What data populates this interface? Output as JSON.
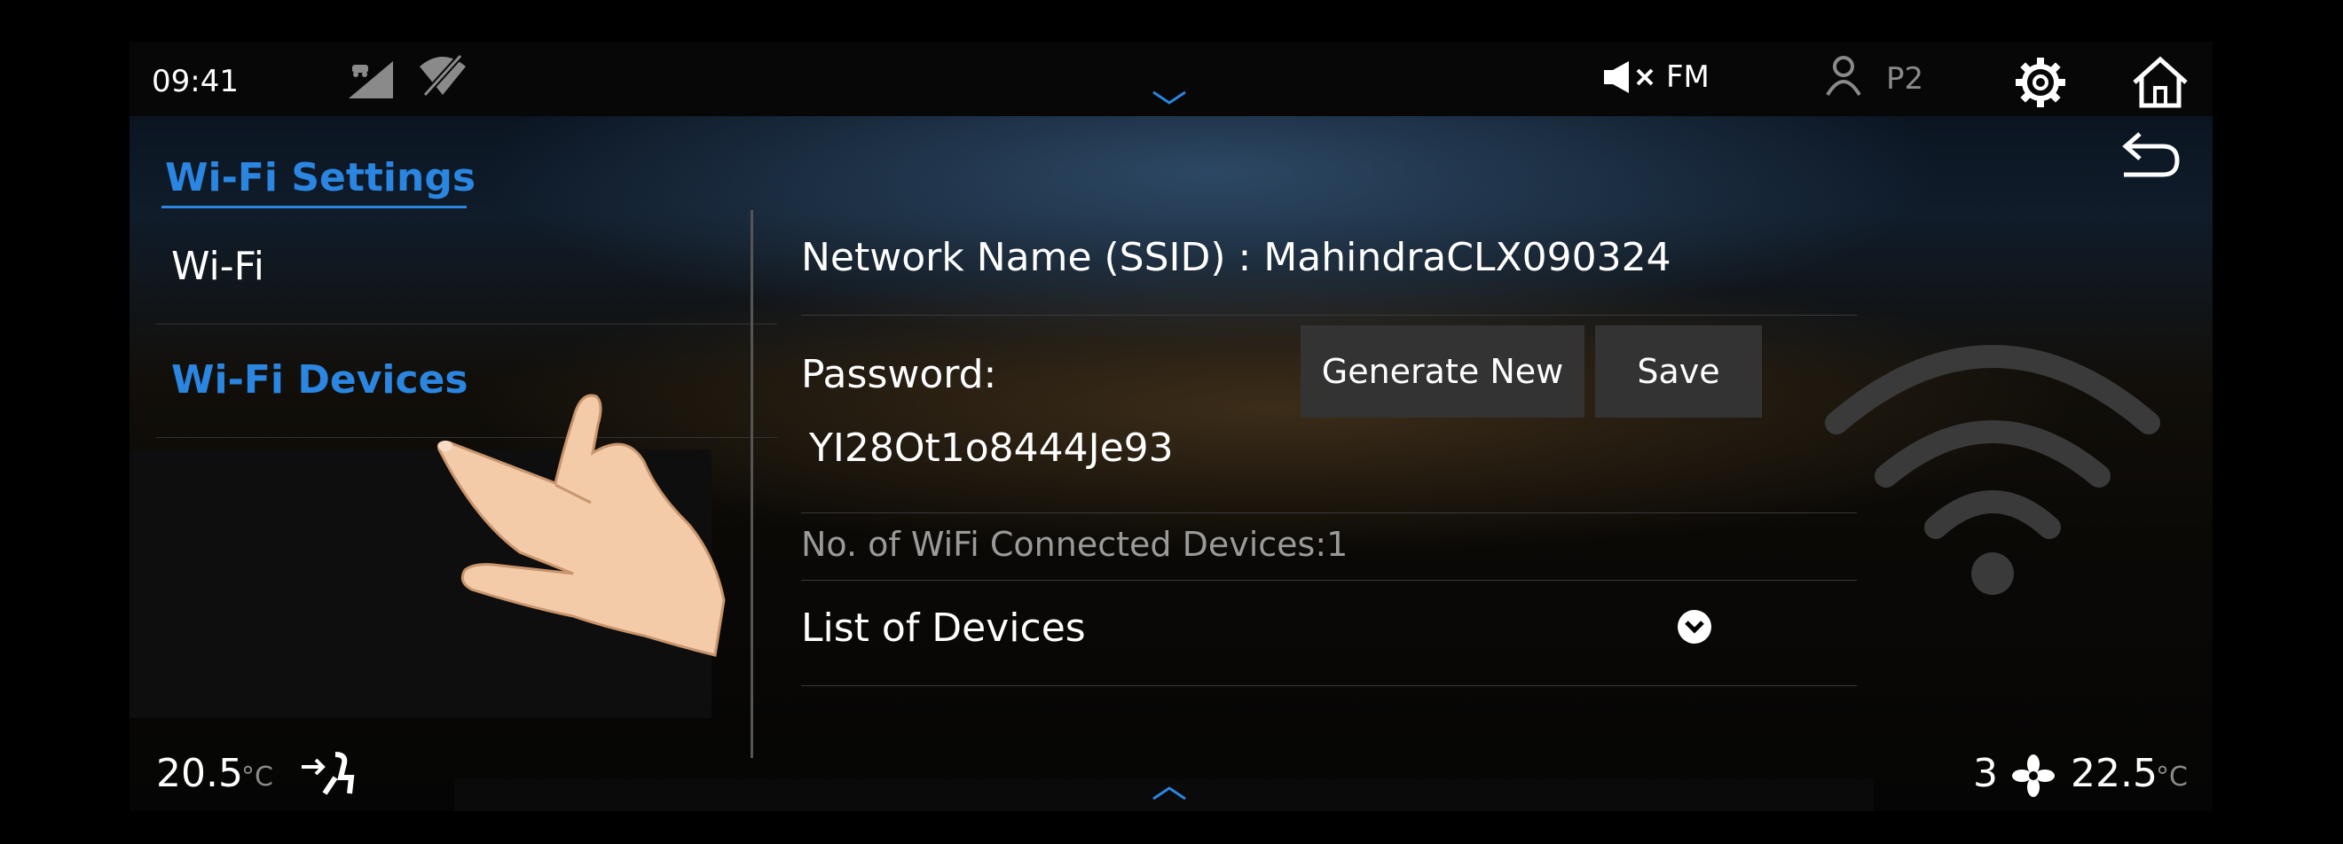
{
  "status_bar": {
    "time": "09:41",
    "audio_source": "FM",
    "profile": "P2"
  },
  "sidebar": {
    "title": "Wi-Fi Settings",
    "items": [
      {
        "label": "Wi-Fi",
        "active": false
      },
      {
        "label": "Wi-Fi Devices",
        "active": true
      }
    ]
  },
  "main": {
    "network_name": "Network Name (SSID) : MahindraCLX090324",
    "password_label": "Password:",
    "password_value": "YI28Ot1o8444Je93",
    "generate_new_label": "Generate New",
    "save_label": "Save",
    "connected_devices": "No. of WiFi Connected Devices:1",
    "list_of_devices_label": "List of Devices"
  },
  "climate": {
    "left_temp": "20.5",
    "left_unit": "°C",
    "fan_speed": "3",
    "right_temp": "22.5",
    "right_unit": "°C"
  },
  "colors": {
    "accent": "#2a86e0",
    "button_bg": "#333333",
    "background": "#050505"
  },
  "icons": [
    "car-signal-icon",
    "signal-strength-icon",
    "wifi-off-icon",
    "mute-icon",
    "user-icon",
    "gear-icon",
    "home-icon",
    "back-icon",
    "chevron-down-icon",
    "chevron-up-icon",
    "expand-icon",
    "wifi-icon",
    "seat-airflow-icon",
    "fan-icon"
  ]
}
